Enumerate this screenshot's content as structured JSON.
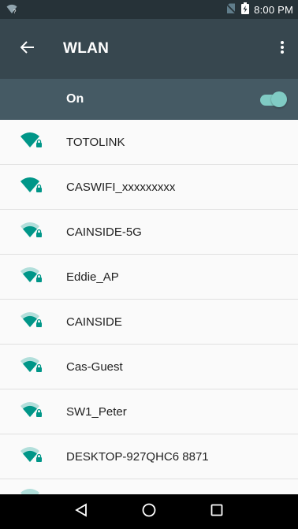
{
  "status_bar": {
    "time": "8:00 PM",
    "icons": [
      "wifi-question-icon",
      "no-sim-icon",
      "battery-charging-icon"
    ]
  },
  "app_bar": {
    "title": "WLAN",
    "back_icon": "back-arrow-icon",
    "menu_icon": "more-vert-icon"
  },
  "master_switch": {
    "label": "On",
    "state": "on",
    "accent": "#80cbc4"
  },
  "networks": [
    {
      "name": "TOTOLINK",
      "secured": true,
      "signal": "full"
    },
    {
      "name": "CASWIFI_xxxxxxxxx",
      "secured": true,
      "signal": "full"
    },
    {
      "name": "CAINSIDE-5G",
      "secured": true,
      "signal": "partial"
    },
    {
      "name": "Eddie_AP",
      "secured": true,
      "signal": "partial"
    },
    {
      "name": "CAINSIDE",
      "secured": true,
      "signal": "partial"
    },
    {
      "name": "Cas-Guest",
      "secured": true,
      "signal": "partial"
    },
    {
      "name": "SW1_Peter",
      "secured": true,
      "signal": "partial"
    },
    {
      "name": "DESKTOP-927QHC6 8871",
      "secured": true,
      "signal": "partial"
    }
  ],
  "nav_bar": {
    "icons": [
      "back-triangle-icon",
      "home-circle-icon",
      "recents-square-icon"
    ]
  },
  "colors": {
    "status_bar": "#263238",
    "app_bar": "#37474f",
    "switch_bar": "#455a64",
    "wifi": "#009688"
  }
}
